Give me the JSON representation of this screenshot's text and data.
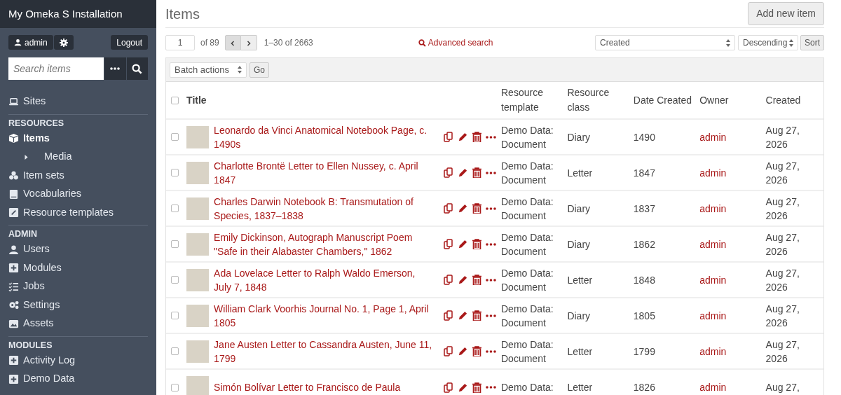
{
  "sidebar": {
    "title": "My Omeka S Installation",
    "user": "admin",
    "logout": "Logout",
    "search": {
      "placeholder": "Search items"
    },
    "sections": [
      {
        "items": [
          {
            "label": "Sites",
            "kind": "laptop",
            "selected": false
          }
        ]
      },
      {
        "heading": "RESOURCES",
        "items": [
          {
            "label": "Items",
            "kind": "cube",
            "selected": true,
            "children": [
              {
                "label": "Media",
                "kind": "caret",
                "selected": false
              }
            ]
          },
          {
            "label": "Item sets",
            "kind": "cubes",
            "selected": false
          },
          {
            "label": "Vocabularies",
            "kind": "book",
            "selected": false
          },
          {
            "label": "Resource templates",
            "kind": "edit",
            "selected": false
          }
        ]
      },
      {
        "heading": "ADMIN",
        "items": [
          {
            "label": "Users",
            "kind": "user",
            "selected": false
          },
          {
            "label": "Modules",
            "kind": "plus",
            "selected": false
          },
          {
            "label": "Jobs",
            "kind": "tasks",
            "selected": false
          },
          {
            "label": "Settings",
            "kind": "gears",
            "selected": false
          },
          {
            "label": "Assets",
            "kind": "image",
            "selected": false
          }
        ]
      },
      {
        "heading": "MODULES",
        "items": [
          {
            "label": "Activity Log",
            "kind": "plus",
            "selected": false
          },
          {
            "label": "Demo Data",
            "kind": "plus",
            "selected": false
          }
        ]
      }
    ]
  },
  "page": {
    "title": "Items",
    "add_button": "Add new item"
  },
  "pagination": {
    "page": "1",
    "of": "of 89",
    "range": "1–30 of 2663"
  },
  "advanced_search": "Advanced search",
  "sort": {
    "field": "Created",
    "order": "Descending",
    "button": "Sort"
  },
  "batch": {
    "select": "Batch actions",
    "button": "Go"
  },
  "table": {
    "select_all_checked": false,
    "columns": [
      "Title",
      "Resource template",
      "Resource class",
      "Date Created",
      "Owner",
      "Created"
    ],
    "rows": [
      {
        "checked": false,
        "title": "Leonardo da Vinci Anatomical Notebook Page, c. 1490s",
        "template": "Demo Data: Document",
        "class": "Diary",
        "date": "1490",
        "owner": "admin",
        "created": "Aug 27, 2026"
      },
      {
        "checked": false,
        "title": "Charlotte Brontë Letter to Ellen Nussey, c. April 1847",
        "template": "Demo Data: Document",
        "class": "Letter",
        "date": "1847",
        "owner": "admin",
        "created": "Aug 27, 2026"
      },
      {
        "checked": false,
        "title": "Charles Darwin Notebook B: Transmutation of Species, 1837–1838",
        "template": "Demo Data: Document",
        "class": "Diary",
        "date": "1837",
        "owner": "admin",
        "created": "Aug 27, 2026"
      },
      {
        "checked": false,
        "title": "Emily Dickinson, Autograph Manuscript Poem \"Safe in their Alabaster Chambers,\" 1862",
        "template": "Demo Data: Document",
        "class": "Diary",
        "date": "1862",
        "owner": "admin",
        "created": "Aug 27, 2026"
      },
      {
        "checked": false,
        "title": "Ada Lovelace Letter to Ralph Waldo Emerson, July 7, 1848",
        "template": "Demo Data: Document",
        "class": "Letter",
        "date": "1848",
        "owner": "admin",
        "created": "Aug 27, 2026"
      },
      {
        "checked": false,
        "title": "William Clark Voorhis Journal No. 1, Page 1, April 1805",
        "template": "Demo Data: Document",
        "class": "Diary",
        "date": "1805",
        "owner": "admin",
        "created": "Aug 27, 2026"
      },
      {
        "checked": false,
        "title": "Jane Austen Letter to Cassandra Austen, June 11, 1799",
        "template": "Demo Data: Document",
        "class": "Letter",
        "date": "1799",
        "owner": "admin",
        "created": "Aug 27, 2026"
      },
      {
        "checked": false,
        "title": "Simón Bolívar Letter to Francisco de Paula",
        "template": "Demo Data:",
        "class": "Letter",
        "date": "1826",
        "owner": "admin",
        "created": "Aug 27,"
      }
    ]
  }
}
